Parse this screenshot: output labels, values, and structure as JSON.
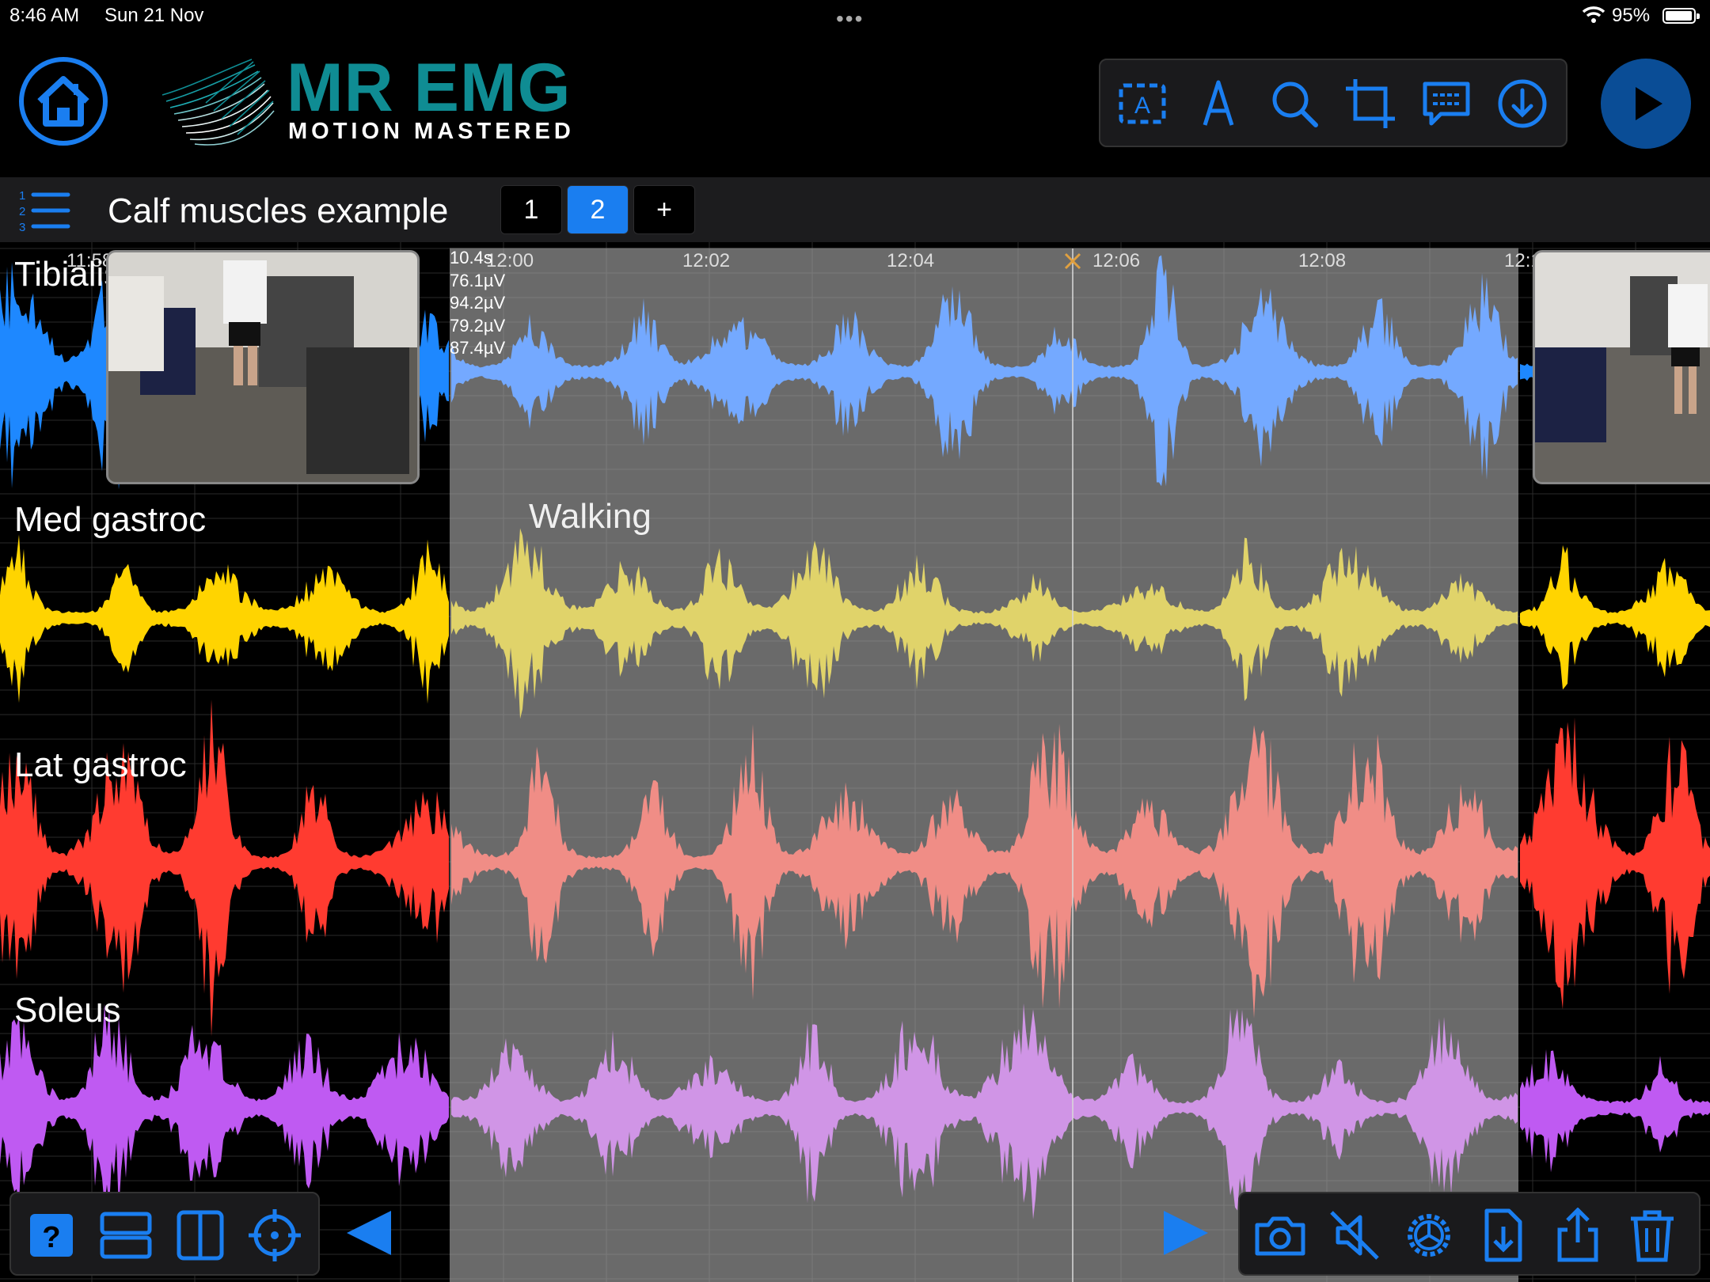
{
  "status_bar": {
    "time": "8:46 AM",
    "date": "Sun 21 Nov",
    "battery": "95%",
    "battery_level": 0.95
  },
  "header": {
    "logo_title": "MR EMG",
    "logo_subtitle": "MOTION MASTERED"
  },
  "toolbar_top": {
    "icons": [
      "text-box-icon",
      "pen-icon",
      "search-icon",
      "crop-icon",
      "comment-icon",
      "download-icon"
    ]
  },
  "document": {
    "title": "Calf muscles example",
    "pages": [
      "1",
      "2"
    ],
    "active_page": "2",
    "add_page_label": "+"
  },
  "chart_data": {
    "type": "area",
    "time_ticks": [
      "11:58",
      "12:00",
      "12:02",
      "12:04",
      "12:06",
      "12:08",
      "12:1"
    ],
    "cursor_time_label": "12:06",
    "channels": [
      {
        "name": "Tibialis ant",
        "color": "#1e88ff"
      },
      {
        "name": "Med gastroc",
        "color": "#ffd400"
      },
      {
        "name": "Lat gastroc",
        "color": "#ff3b30"
      },
      {
        "name": "Soleus",
        "color": "#bf5af2"
      }
    ],
    "selection": {
      "label": "Walking"
    },
    "readout": [
      "10.4s",
      "76.1µV",
      "94.2µV",
      "79.2µV",
      "87.4µV"
    ]
  },
  "bottom_toolbar_left": {
    "icons": [
      "help-icon",
      "split-horizontal-icon",
      "split-vertical-icon",
      "crosshair-icon"
    ]
  },
  "bottom_toolbar_right": {
    "icons": [
      "camera-icon",
      "mute-icon",
      "settings-icon",
      "import-file-icon",
      "share-icon",
      "trash-icon"
    ]
  }
}
